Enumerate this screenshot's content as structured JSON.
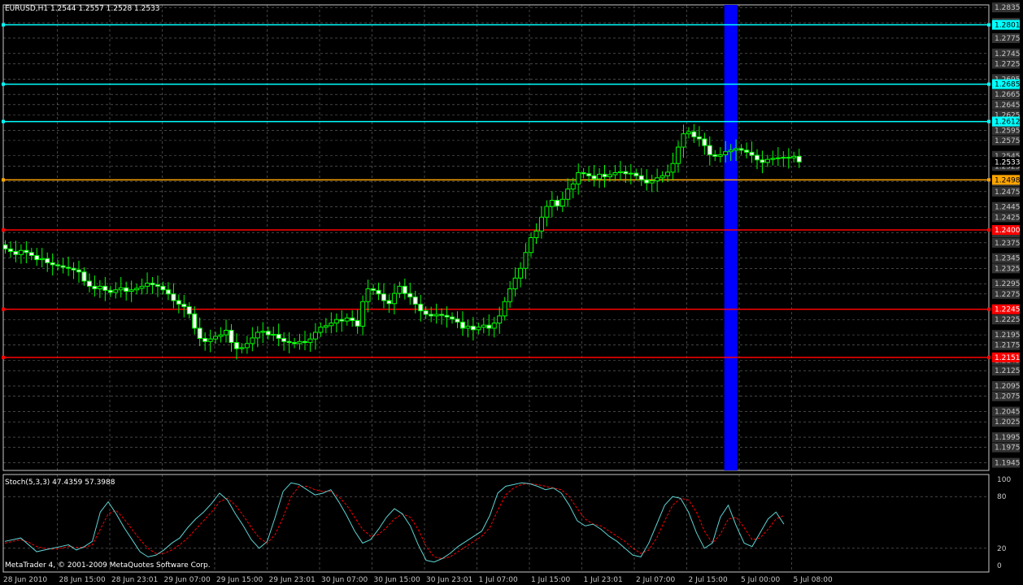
{
  "header": {
    "main": "EURUSD,H1  1.2544 1.2557 1.2528 1.2533",
    "stoch": "Stoch(5,3,3) 47.4359 57.3988",
    "copyright": "MetaTrader 4, © 2001-2009 MetaQuotes Software Corp."
  },
  "colors": {
    "background": "#000000",
    "grid": "#c8c8c8",
    "bull": "#00ff00",
    "bear_body": "#ffffff",
    "cyan": "#00ffff",
    "orange": "#ffa500",
    "red": "#ff0000",
    "highlight": "#0000ff",
    "stoch_main": "#5fd3d3",
    "stoch_signal": "#ff0000"
  },
  "chart_data": [
    {
      "type": "candlestick",
      "symbol": "EURUSD",
      "timeframe": "H1",
      "ylim": [
        1.193,
        1.284
      ],
      "y_ticks": [
        "1.2835",
        "1.2805",
        "1.2775",
        "1.2745",
        "1.2725",
        "1.2695",
        "1.2665",
        "1.2645",
        "1.2625",
        "1.2595",
        "1.2575",
        "1.2545",
        "1.2525",
        "1.2495",
        "1.2475",
        "1.2445",
        "1.2425",
        "1.2395",
        "1.2375",
        "1.2345",
        "1.2325",
        "1.2295",
        "1.2275",
        "1.2245",
        "1.2225",
        "1.2195",
        "1.2175",
        "1.2145",
        "1.2125",
        "1.2095",
        "1.2075",
        "1.2045",
        "1.2025",
        "1.1995",
        "1.1975",
        "1.1945"
      ],
      "x_labels": [
        "28 Jun 2010",
        "28 Jun 15:00",
        "28 Jun 23:01",
        "29 Jun 07:00",
        "29 Jun 15:00",
        "29 Jun 23:01",
        "30 Jun 07:00",
        "30 Jun 15:00",
        "30 Jun 23:01",
        "1 Jul 07:00",
        "1 Jul 15:00",
        "1 Jul 23:01",
        "2 Jul 07:00",
        "2 Jul 15:00",
        "5 Jul 00:00",
        "5 Jul 08:00"
      ],
      "close_series": [
        1.2363,
        1.2358,
        1.2352,
        1.236,
        1.2356,
        1.235,
        1.2342,
        1.2344,
        1.2336,
        1.2332,
        1.233,
        1.2327,
        1.2325,
        1.2322,
        1.2318,
        1.23,
        1.229,
        1.2285,
        1.229,
        1.2282,
        1.2278,
        1.2283,
        1.2287,
        1.228,
        1.2283,
        1.2286,
        1.229,
        1.2296,
        1.2293,
        1.229,
        1.2283,
        1.2275,
        1.2262,
        1.2255,
        1.225,
        1.2236,
        1.2208,
        1.2188,
        1.2182,
        1.2187,
        1.2192,
        1.2195,
        1.2204,
        1.218,
        1.2168,
        1.217,
        1.2178,
        1.2189,
        1.22,
        1.2202,
        1.2195,
        1.2196,
        1.2188,
        1.2182,
        1.218,
        1.2178,
        1.2182,
        1.218,
        1.2187,
        1.22,
        1.221,
        1.2213,
        1.2218,
        1.2225,
        1.2222,
        1.2228,
        1.2223,
        1.2212,
        1.226,
        1.2285,
        1.2282,
        1.2275,
        1.2262,
        1.2256,
        1.2276,
        1.229,
        1.2276,
        1.2269,
        1.2255,
        1.2242,
        1.2235,
        1.2232,
        1.2235,
        1.2233,
        1.223,
        1.2226,
        1.222,
        1.2208,
        1.2212,
        1.2205,
        1.221,
        1.2214,
        1.2208,
        1.2218,
        1.2232,
        1.226,
        1.2285,
        1.2306,
        1.2325,
        1.2356,
        1.2385,
        1.2398,
        1.2425,
        1.2446,
        1.2458,
        1.2447,
        1.246,
        1.248,
        1.249,
        1.2512,
        1.251,
        1.2506,
        1.25,
        1.2509,
        1.2504,
        1.2508,
        1.2512,
        1.2514,
        1.251,
        1.2511,
        1.2506,
        1.2498,
        1.2492,
        1.2496,
        1.2502,
        1.2506,
        1.2513,
        1.253,
        1.2562,
        1.2588,
        1.2592,
        1.2582,
        1.2578,
        1.2565,
        1.2547,
        1.2544,
        1.2547,
        1.2553,
        1.2556,
        1.2559,
        1.2556,
        1.2552,
        1.2546,
        1.2537,
        1.2532,
        1.2538,
        1.254,
        1.2541,
        1.2542,
        1.2541,
        1.2544,
        1.2533
      ],
      "levels": [
        {
          "label": "1.2801",
          "value": 1.2801,
          "color": "#00ffff"
        },
        {
          "label": "1.2685",
          "value": 1.2685,
          "color": "#00ffff"
        },
        {
          "label": "1.2612",
          "value": 1.2612,
          "color": "#00ffff"
        },
        {
          "label": "1.2533",
          "value": 1.2533,
          "color": "#ffffff"
        },
        {
          "label": "1.2498",
          "value": 1.2498,
          "color": "#ffa500"
        },
        {
          "label": "1.2400",
          "value": 1.24,
          "color": "#ff0000"
        },
        {
          "label": "1.2245",
          "value": 1.2245,
          "color": "#ff0000"
        },
        {
          "label": "1.2151",
          "value": 1.2151,
          "color": "#ff0000"
        }
      ],
      "highlight_bar_index": 138
    },
    {
      "type": "line",
      "name": "Stoch(5,3,3)",
      "ylim": [
        0,
        100
      ],
      "y_ticks": [
        "100",
        "80",
        "20",
        "0"
      ],
      "main": [
        28,
        30,
        32,
        24,
        16,
        18,
        20,
        22,
        24,
        18,
        22,
        28,
        62,
        74,
        60,
        44,
        30,
        16,
        10,
        12,
        18,
        26,
        32,
        44,
        54,
        62,
        72,
        84,
        76,
        60,
        46,
        30,
        20,
        28,
        56,
        86,
        96,
        94,
        88,
        82,
        84,
        88,
        74,
        58,
        40,
        26,
        30,
        42,
        56,
        66,
        60,
        46,
        24,
        6,
        4,
        8,
        14,
        22,
        28,
        34,
        40,
        58,
        84,
        92,
        94,
        96,
        95,
        92,
        88,
        90,
        84,
        70,
        52,
        46,
        48,
        42,
        34,
        28,
        20,
        12,
        10,
        26,
        48,
        70,
        80,
        78,
        62,
        38,
        20,
        26,
        56,
        70,
        46,
        26,
        22,
        38,
        54,
        62,
        48
      ],
      "signal": [
        26,
        28,
        30,
        27,
        22,
        20,
        19,
        20,
        22,
        21,
        21,
        24,
        42,
        60,
        64,
        54,
        42,
        30,
        20,
        14,
        14,
        18,
        24,
        32,
        42,
        52,
        62,
        74,
        78,
        70,
        58,
        44,
        32,
        26,
        36,
        56,
        80,
        92,
        92,
        88,
        86,
        86,
        80,
        70,
        56,
        42,
        34,
        36,
        44,
        54,
        60,
        56,
        42,
        22,
        10,
        8,
        10,
        16,
        22,
        28,
        34,
        44,
        64,
        82,
        90,
        94,
        95,
        94,
        92,
        90,
        88,
        80,
        66,
        54,
        48,
        46,
        40,
        34,
        28,
        20,
        14,
        18,
        32,
        52,
        70,
        78,
        76,
        62,
        40,
        26,
        36,
        54,
        56,
        44,
        30,
        32,
        42,
        54,
        58
      ]
    }
  ]
}
